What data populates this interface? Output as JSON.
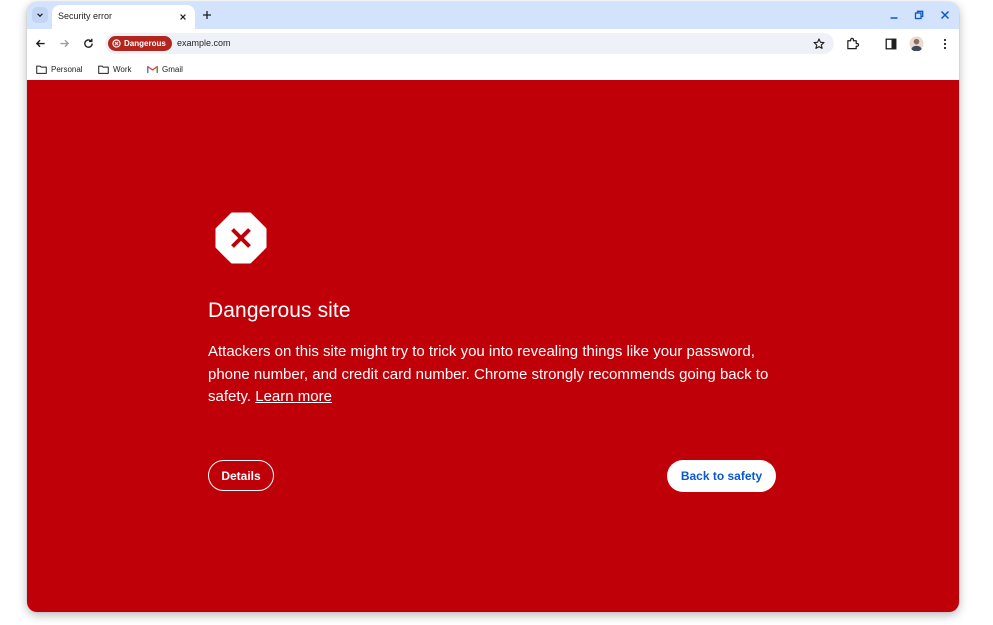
{
  "tab": {
    "title": "Security error"
  },
  "toolbar": {
    "security_chip": "Dangerous",
    "url": "example.com"
  },
  "bookmarks": [
    {
      "label": "Personal",
      "icon": "folder-icon"
    },
    {
      "label": "Work",
      "icon": "folder-icon"
    },
    {
      "label": "Gmail",
      "icon": "gmail-icon"
    }
  ],
  "page": {
    "title": "Dangerous site",
    "body": "Attackers on this site might try to trick you into revealing things like your password, phone number, and credit card number. Chrome strongly recommends going back to safety.",
    "learn_more": "Learn more",
    "details_button": "Details",
    "back_button": "Back to safety"
  },
  "colors": {
    "danger_background": "#c00008",
    "tab_strip": "#d3e3fd",
    "chip": "#b3261e",
    "primary_button_text": "#0b57d0"
  }
}
